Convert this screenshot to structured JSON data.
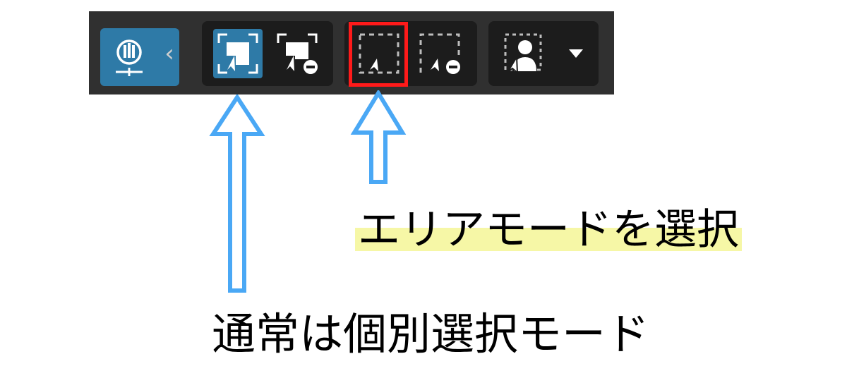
{
  "toolbar": {
    "background": "#303030",
    "group_background": "#1c1c1c",
    "active_color": "#2e7aa7",
    "buttons": [
      {
        "name": "accessibility-panel-button",
        "icon": "accessibility-icon",
        "active": true
      },
      {
        "name": "collapse-chevron",
        "icon": "chevron-left-icon",
        "glyph": "‹"
      },
      {
        "name": "individual-select-mode-button",
        "icon": "individual-select-icon",
        "active": true
      },
      {
        "name": "individual-deselect-button",
        "icon": "individual-deselect-icon"
      },
      {
        "name": "area-select-mode-button",
        "icon": "area-select-icon",
        "highlighted": true
      },
      {
        "name": "area-deselect-button",
        "icon": "area-deselect-icon"
      },
      {
        "name": "person-area-select-button",
        "icon": "person-select-icon"
      },
      {
        "name": "person-select-dropdown",
        "icon": "caret-down-icon"
      }
    ]
  },
  "annotations": {
    "highlight_color": "#ff1a1a",
    "arrow_color": "#4aa8f5",
    "marker_color": "#f6f7a6",
    "area_mode_label": "エリアモードを選択",
    "normal_mode_label": "通常は個別選択モード"
  }
}
